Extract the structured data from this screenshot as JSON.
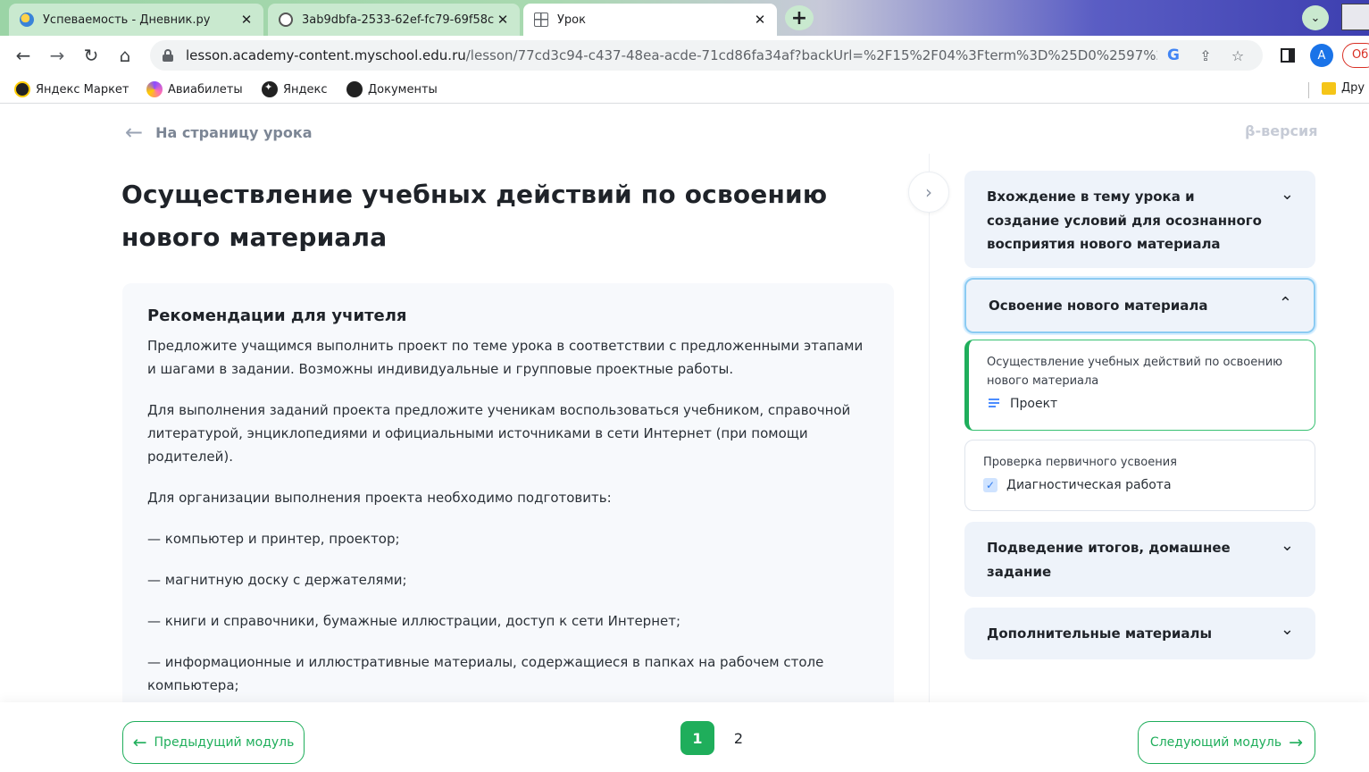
{
  "browser": {
    "tabs": [
      {
        "title": "Успеваемость - Дневник.ру",
        "icon": "diary-favicon"
      },
      {
        "title": "3ab9dbfa-2533-62ef-fc79-69f58c",
        "icon": "globe-favicon"
      },
      {
        "title": "Урок",
        "icon": "grid-favicon"
      }
    ],
    "close_glyph": "✕",
    "url_host": "lesson.academy-content.myschool.edu.ru",
    "url_path": "/lesson/77cd3c94-c437-48ea-acde-71cd86fa34af?backUrl=%2F15%2F04%3Fterm%3D%25D0%2597%25...",
    "avatar_letter": "A",
    "update_label": "Об",
    "bookmarks": [
      {
        "label": "Яндекс Маркет"
      },
      {
        "label": "Авиабилеты"
      },
      {
        "label": "Яндекс"
      },
      {
        "label": "Документы"
      }
    ],
    "other_bookmarks": "Дру"
  },
  "page": {
    "back_label": "На страницу урока",
    "beta_label": "β-версия",
    "title": "Осуществление учебных действий по освоению нового материала",
    "recommendations": {
      "heading": "Рекомендации для учителя",
      "paragraphs": [
        "Предложите учащимся выполнить проект по теме урока в соответствии с предложенными этапами и шагами в задании. Возможны индивидуальные и групповые проектные работы.",
        "Для выполнения заданий проекта предложите ученикам воспользоваться учебником, справочной литературой, энциклопедиями и официальными источниками в сети Интернет (при помощи родителей).",
        "Для организации выполнения проекта необходимо подготовить:",
        "— компьютер и принтер, проектор;",
        "— магнитную доску с держателями;",
        "— книги и справочники, бумажные иллюстрации, доступ к сети Интернет;",
        "— информационные и иллюстративные материалы, содержащиеся в папках на рабочем столе компьютера;"
      ]
    },
    "footer": {
      "prev_label": "Предыдущий модуль",
      "next_label": "Следующий модуль",
      "pages": [
        "1",
        "2"
      ],
      "current_page": "1"
    }
  },
  "sidebar": {
    "sections": [
      {
        "title": "Вхождение в тему урока и создание условий для осознанного восприятия нового материала",
        "expanded": false
      },
      {
        "title": "Освоение нового материала",
        "expanded": true
      },
      {
        "title": "Подведение итогов, домашнее задание",
        "expanded": false
      },
      {
        "title": "Дополнительные материалы",
        "expanded": false
      }
    ],
    "items": [
      {
        "title": "Осуществление учебных действий по освоению нового материала",
        "tag": "Проект",
        "active": true
      },
      {
        "title": "Проверка первичного усвоения",
        "tag": "Диагностическая работа",
        "active": false
      }
    ]
  },
  "colors": {
    "accent_green": "#1fae5b",
    "sidebar_bg": "#eef3fa",
    "active_section_border": "#8ccbf2"
  }
}
